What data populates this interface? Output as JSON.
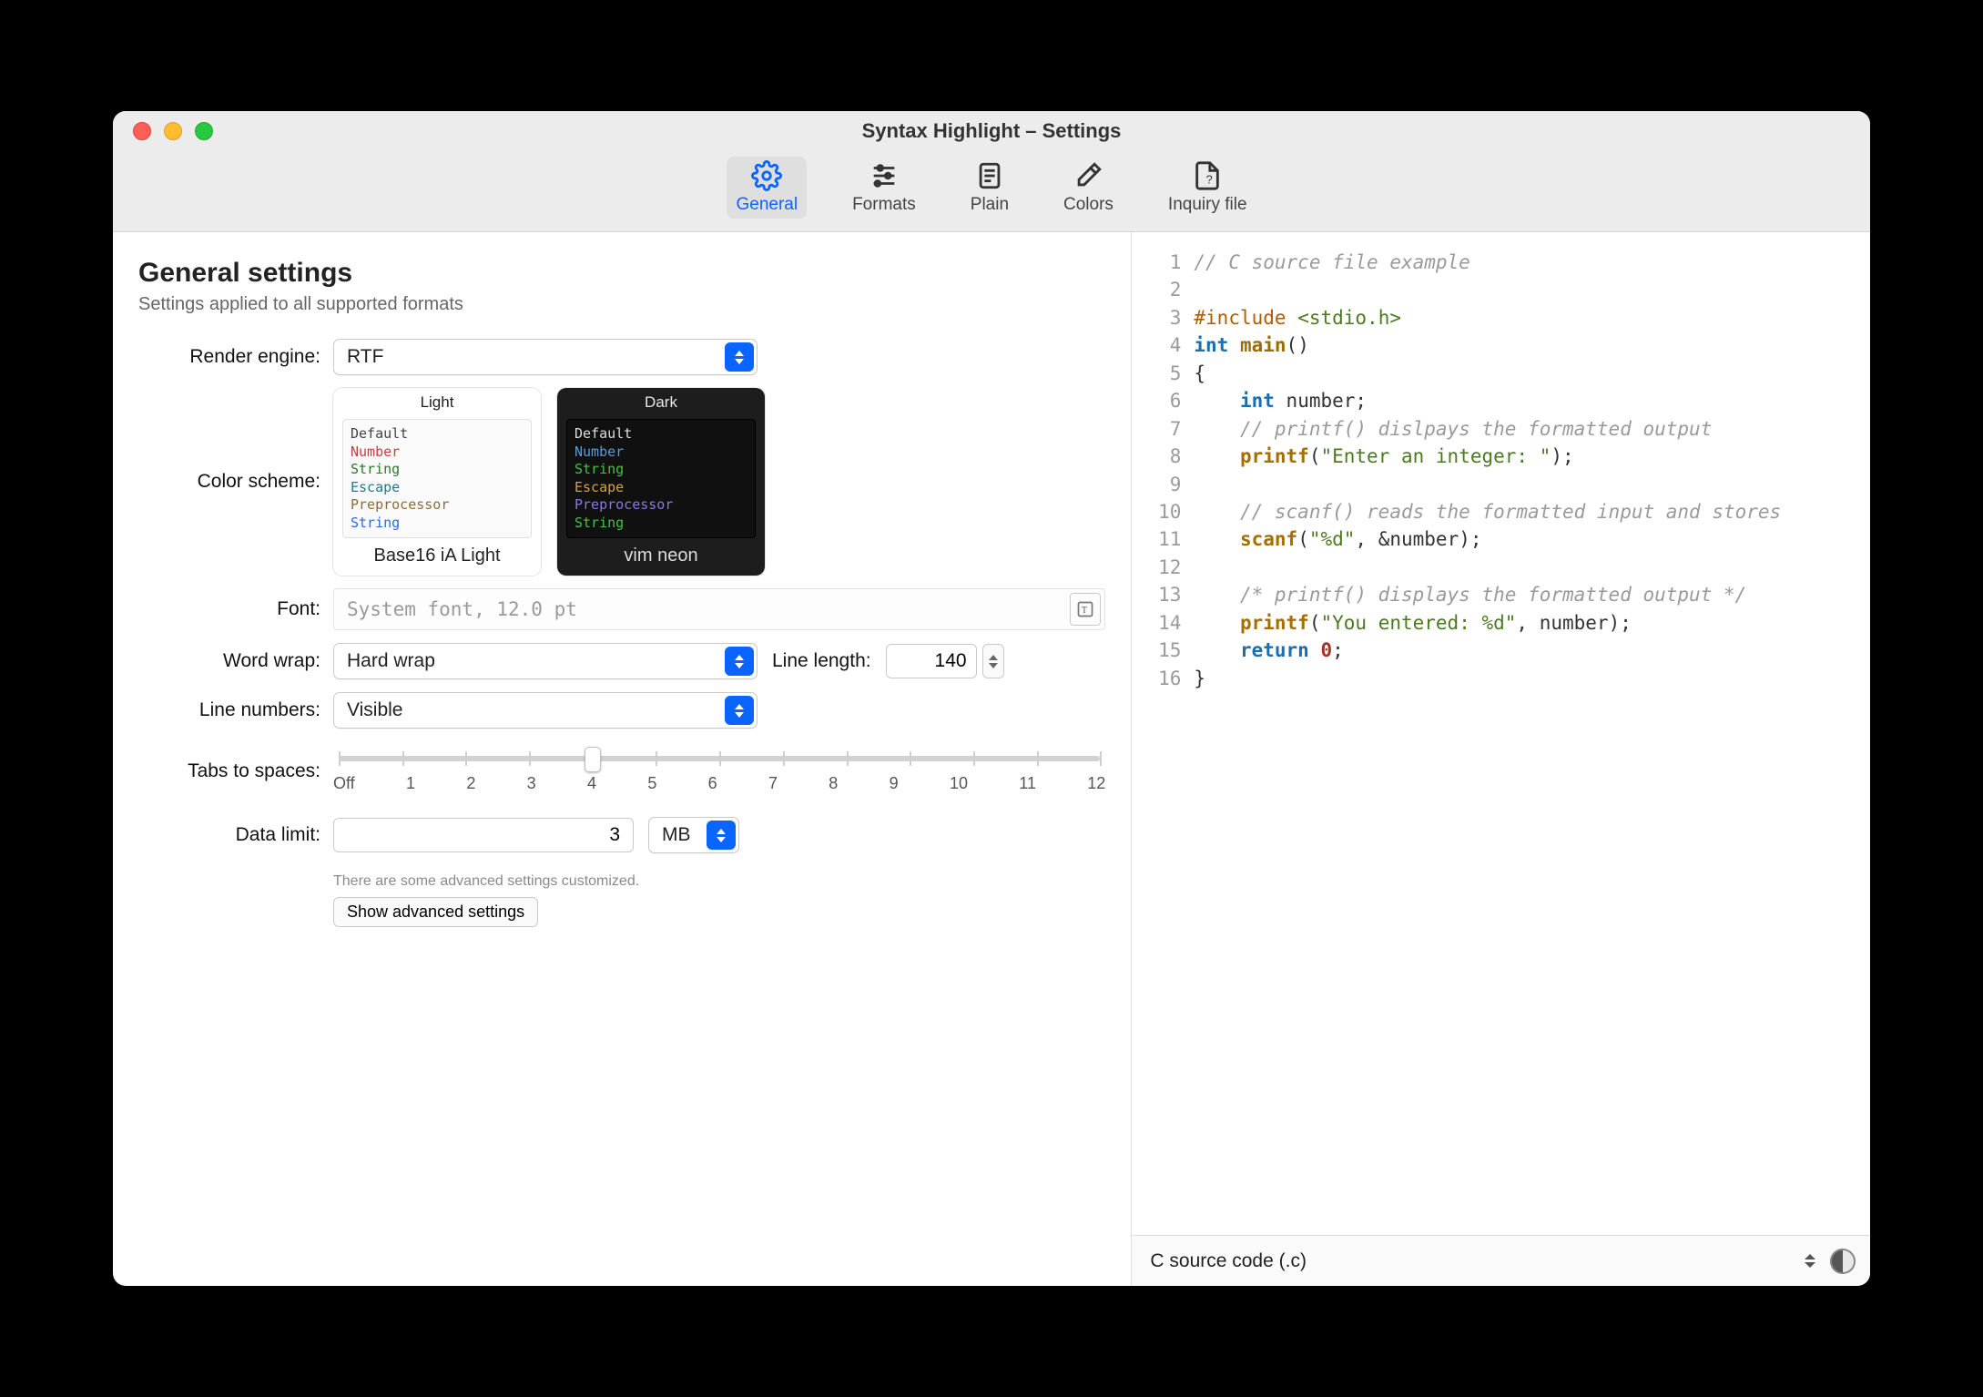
{
  "window": {
    "title": "Syntax Highlight – Settings"
  },
  "toolbar": {
    "items": [
      {
        "id": "general",
        "label": "General",
        "active": true
      },
      {
        "id": "formats",
        "label": "Formats"
      },
      {
        "id": "plain",
        "label": "Plain"
      },
      {
        "id": "colors",
        "label": "Colors"
      },
      {
        "id": "inquiry",
        "label": "Inquiry file"
      }
    ]
  },
  "section": {
    "title": "General settings",
    "subtitle": "Settings applied to all supported formats"
  },
  "labels": {
    "render_engine": "Render engine:",
    "color_scheme": "Color scheme:",
    "font": "Font:",
    "word_wrap": "Word wrap:",
    "line_length": "Line length:",
    "line_numbers": "Line numbers:",
    "tabs_to_spaces": "Tabs to spaces:",
    "data_limit": "Data limit:"
  },
  "render_engine": {
    "value": "RTF"
  },
  "color_scheme": {
    "light": {
      "header": "Light",
      "name": "Base16 iA Light",
      "sample": {
        "default": "Default",
        "number": "Number",
        "string": "String",
        "escape": "Escape",
        "preprocessor": "Preprocessor",
        "string2": "String"
      }
    },
    "dark": {
      "header": "Dark",
      "name": "vim neon",
      "sample": {
        "default": "Default",
        "number": "Number",
        "string": "String",
        "escape": "Escape",
        "preprocessor": "Preprocessor",
        "string2": "String"
      }
    }
  },
  "font": {
    "display": "System font, 12.0 pt"
  },
  "word_wrap": {
    "value": "Hard wrap"
  },
  "line_length": {
    "value": "140"
  },
  "line_numbers": {
    "value": "Visible"
  },
  "tabs_slider": {
    "ticks": [
      "Off",
      "1",
      "2",
      "3",
      "4",
      "5",
      "6",
      "7",
      "8",
      "9",
      "10",
      "11",
      "12"
    ],
    "selected_index": 4
  },
  "data_limit": {
    "value": "3",
    "unit": "MB"
  },
  "advanced": {
    "note": "There are some advanced settings customized.",
    "button": "Show advanced settings"
  },
  "preview": {
    "language_selector": "C source code (.c)",
    "code": [
      {
        "n": 1,
        "frags": [
          {
            "cls": "c-comment",
            "t": "// C source file example"
          }
        ]
      },
      {
        "n": 2,
        "frags": []
      },
      {
        "n": 3,
        "frags": [
          {
            "cls": "c-prep",
            "t": "#include "
          },
          {
            "cls": "c-inc",
            "t": "<stdio.h>"
          }
        ]
      },
      {
        "n": 4,
        "frags": [
          {
            "cls": "c-kw",
            "t": "int "
          },
          {
            "cls": "c-ident",
            "t": "main"
          },
          {
            "cls": "c-punct",
            "t": "()"
          }
        ]
      },
      {
        "n": 5,
        "frags": [
          {
            "cls": "c-punct",
            "t": "{"
          }
        ]
      },
      {
        "n": 6,
        "frags": [
          {
            "cls": "",
            "t": "    "
          },
          {
            "cls": "c-kw",
            "t": "int "
          },
          {
            "cls": "c-punct",
            "t": "number;"
          }
        ]
      },
      {
        "n": 7,
        "frags": [
          {
            "cls": "",
            "t": "    "
          },
          {
            "cls": "c-comment",
            "t": "// printf() dislpays the formatted output"
          }
        ]
      },
      {
        "n": 8,
        "frags": [
          {
            "cls": "",
            "t": "    "
          },
          {
            "cls": "c-func",
            "t": "printf"
          },
          {
            "cls": "c-punct",
            "t": "("
          },
          {
            "cls": "c-str",
            "t": "\"Enter an integer: \""
          },
          {
            "cls": "c-punct",
            "t": ");"
          }
        ]
      },
      {
        "n": 9,
        "frags": []
      },
      {
        "n": 10,
        "frags": [
          {
            "cls": "",
            "t": "    "
          },
          {
            "cls": "c-comment",
            "t": "// scanf() reads the formatted input and stores"
          }
        ]
      },
      {
        "n": 11,
        "frags": [
          {
            "cls": "",
            "t": "    "
          },
          {
            "cls": "c-func",
            "t": "scanf"
          },
          {
            "cls": "c-punct",
            "t": "("
          },
          {
            "cls": "c-str",
            "t": "\"%d\""
          },
          {
            "cls": "c-punct",
            "t": ", &number);"
          }
        ]
      },
      {
        "n": 12,
        "frags": []
      },
      {
        "n": 13,
        "frags": [
          {
            "cls": "",
            "t": "    "
          },
          {
            "cls": "c-comment",
            "t": "/* printf() displays the formatted output */"
          }
        ]
      },
      {
        "n": 14,
        "frags": [
          {
            "cls": "",
            "t": "    "
          },
          {
            "cls": "c-func",
            "t": "printf"
          },
          {
            "cls": "c-punct",
            "t": "("
          },
          {
            "cls": "c-str",
            "t": "\"You entered: %d\""
          },
          {
            "cls": "c-punct",
            "t": ", number);"
          }
        ]
      },
      {
        "n": 15,
        "frags": [
          {
            "cls": "",
            "t": "    "
          },
          {
            "cls": "c-kw",
            "t": "return "
          },
          {
            "cls": "c-num",
            "t": "0"
          },
          {
            "cls": "c-punct",
            "t": ";"
          }
        ]
      },
      {
        "n": 16,
        "frags": [
          {
            "cls": "c-punct",
            "t": "}"
          }
        ]
      }
    ]
  }
}
